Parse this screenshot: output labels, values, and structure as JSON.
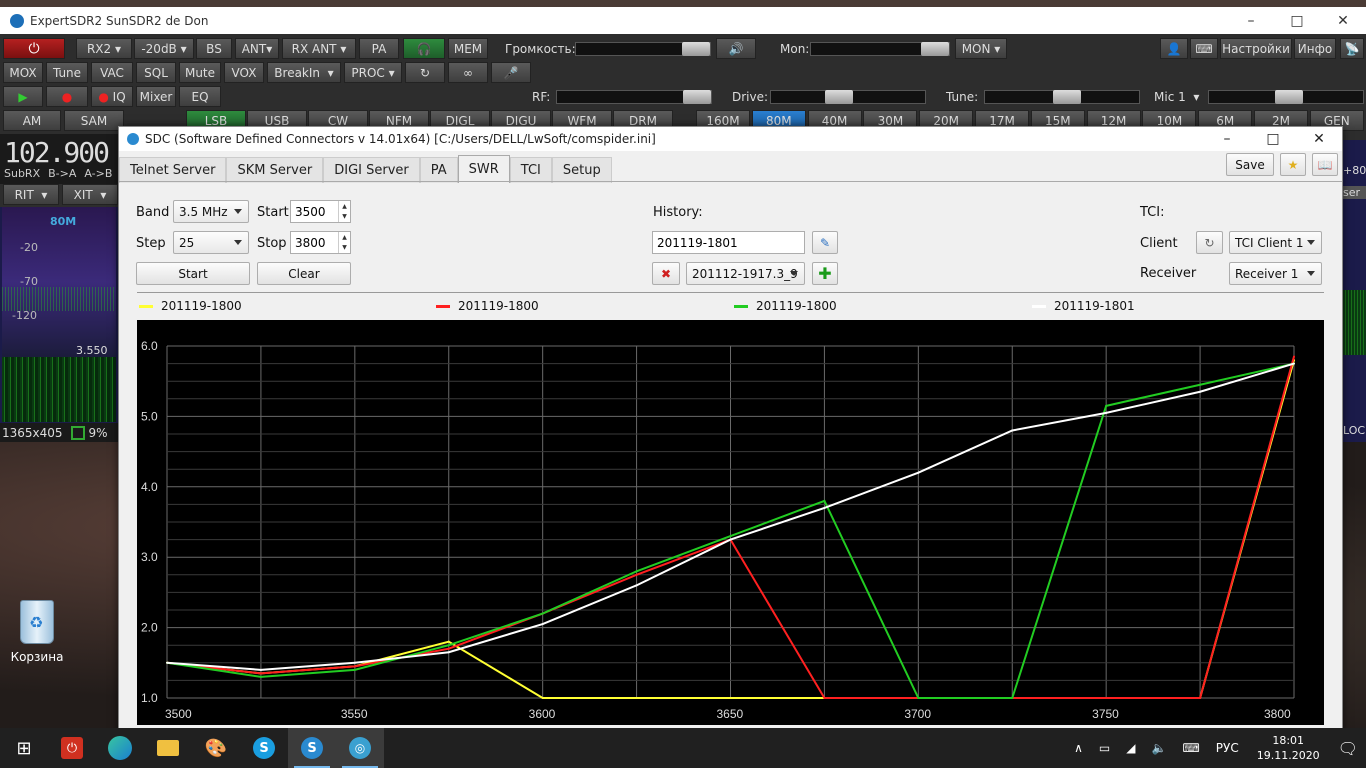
{
  "main_window": {
    "title": "ExpertSDR2 SunSDR2   de Don",
    "row1": {
      "rx2": "RX2",
      "att": "-20dB",
      "bs": "BS",
      "ant": "ANT",
      "rx_ant": "RX ANT",
      "pa": "PA",
      "mem": "MEM",
      "volume_label": "Громкость:",
      "mon_label": "Mon:",
      "mon_btn": "MON",
      "settings": "Настройки",
      "info": "Инфо"
    },
    "row2": {
      "mox": "MOX",
      "tune": "Tune",
      "vac": "VAC",
      "sql": "SQL",
      "mute": "Mute",
      "vox": "VOX",
      "breakin": "BreakIn",
      "proc": "PROC"
    },
    "row3": {
      "iq": "IQ",
      "mixer": "Mixer",
      "eq": "EQ",
      "rf_label": "RF:",
      "drive_label": "Drive:",
      "tune_label": "Tune:",
      "mic": "Mic 1"
    },
    "modes": [
      "AM",
      "SAM",
      "LSB",
      "USB",
      "CW",
      "NFM",
      "DIGL",
      "DIGU",
      "WFM",
      "DRM"
    ],
    "bands": [
      "160M",
      "80M",
      "40M",
      "30M",
      "20M",
      "17M",
      "15M",
      "12M",
      "10M",
      "6M",
      "2M",
      "GEN"
    ],
    "freq_display": "102.900",
    "sub_labels": {
      "subrx": "SubRX",
      "b_a": "B->A",
      "a_b": "A->B",
      "rit": "RIT",
      "xit": "XIT"
    },
    "spectrum": {
      "band": "80M",
      "levels": [
        "-20",
        "-70",
        "-120"
      ],
      "freq": "3.550"
    },
    "status": {
      "resolution": "1365x405",
      "cpu": "9%"
    },
    "right_labels": {
      "plus80": "+80",
      "ser": "ser",
      "loc": "LOC"
    }
  },
  "dialog": {
    "title": "SDC (Software Defined Connectors v 14.01x64) [C:/Users/DELL/LwSoft/comspider.ini]",
    "tabs": [
      "Telnet Server",
      "SKM Server",
      "DIGI Server",
      "PA",
      "SWR",
      "TCI",
      "Setup"
    ],
    "active_tab": "SWR",
    "save": "Save",
    "band_label": "Band",
    "band_value": "3.5 MHz",
    "start_label": "Start",
    "start_value": "3500",
    "step_label": "Step",
    "step_value": "25",
    "stop_label": "Stop",
    "stop_value": "3800",
    "start_btn": "Start",
    "clear_btn": "Clear",
    "history_label": "History:",
    "history_value": "201119-1801",
    "history_select": "201112-1917.3_9",
    "tci_label": "TCI:",
    "client_label": "Client",
    "client_value": "TCI Client 1",
    "receiver_label": "Receiver",
    "receiver_value": "Receiver 1"
  },
  "chart_data": {
    "type": "line",
    "x": [
      3500,
      3525,
      3550,
      3575,
      3600,
      3625,
      3650,
      3675,
      3700,
      3725,
      3750,
      3775,
      3800
    ],
    "xlim": [
      3500,
      3800
    ],
    "ylim": [
      1.0,
      6.0
    ],
    "x_ticks": [
      "3500",
      "3550",
      "3600",
      "3650",
      "3700",
      "3750",
      "3800"
    ],
    "y_ticks": [
      "1.0",
      "2.0",
      "3.0",
      "4.0",
      "5.0",
      "6.0"
    ],
    "grid": true,
    "legend_position": "top",
    "series": [
      {
        "name": "201119-1800",
        "color": "#ffff33",
        "values": [
          1.5,
          1.35,
          1.45,
          1.8,
          1.0,
          1.0,
          1.0,
          1.0,
          1.0,
          1.0,
          1.0,
          1.0,
          5.8
        ]
      },
      {
        "name": "201119-1800",
        "color": "#ff2020",
        "values": [
          1.5,
          1.35,
          1.45,
          1.7,
          2.2,
          2.75,
          3.25,
          1.0,
          1.0,
          1.0,
          1.0,
          1.0,
          5.85
        ]
      },
      {
        "name": "201119-1800",
        "color": "#22cc22",
        "values": [
          1.5,
          1.3,
          1.4,
          1.75,
          2.2,
          2.8,
          3.3,
          3.8,
          1.0,
          1.0,
          5.15,
          5.45,
          5.75
        ]
      },
      {
        "name": "201119-1801",
        "color": "#ffffff",
        "values": [
          1.5,
          1.4,
          1.5,
          1.65,
          2.05,
          2.6,
          3.25,
          3.7,
          4.2,
          4.8,
          5.05,
          5.35,
          5.75
        ]
      }
    ]
  },
  "desktop": {
    "recycle_bin": "Корзина"
  },
  "taskbar": {
    "lang": "РУС",
    "time": "18:01",
    "date": "19.11.2020"
  }
}
